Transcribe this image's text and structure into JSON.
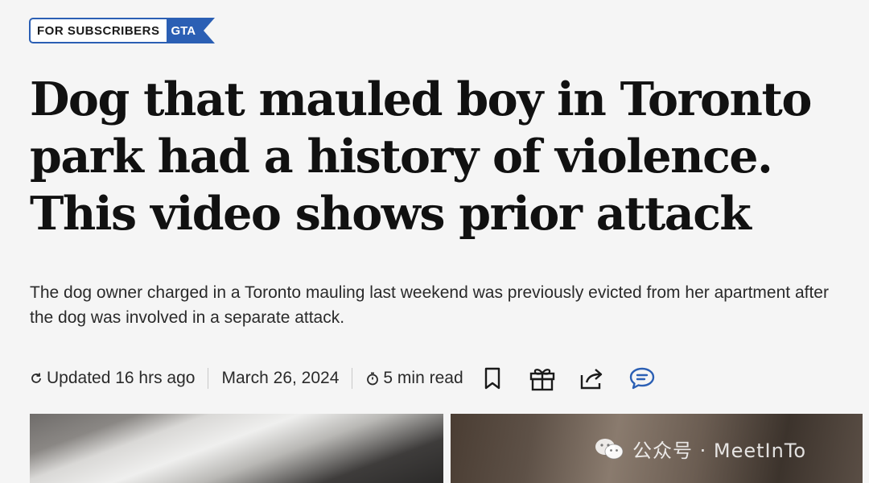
{
  "badge": {
    "subscribers_label": "FOR SUBSCRIBERS",
    "section_label": "GTA"
  },
  "article": {
    "headline": "Dog that mauled boy in Toronto park had a history of violence. This video shows prior attack",
    "dek": "The dog owner charged in a Toronto mauling last weekend was previously evicted from her apartment after the dog was involved in a separate attack."
  },
  "meta": {
    "updated": "Updated 16 hrs ago",
    "date": "March 26, 2024",
    "read_time": "5 min read"
  },
  "actions": [
    {
      "name": "bookmark",
      "icon": "bookmark-icon"
    },
    {
      "name": "gift",
      "icon": "gift-icon"
    },
    {
      "name": "share",
      "icon": "share-icon"
    },
    {
      "name": "comments",
      "icon": "comment-icon"
    }
  ],
  "watermark": {
    "text": "公众号 · MeetInTo"
  },
  "colors": {
    "accent": "#2b5fb4",
    "background": "#f5f5f5",
    "text": "#111111"
  }
}
